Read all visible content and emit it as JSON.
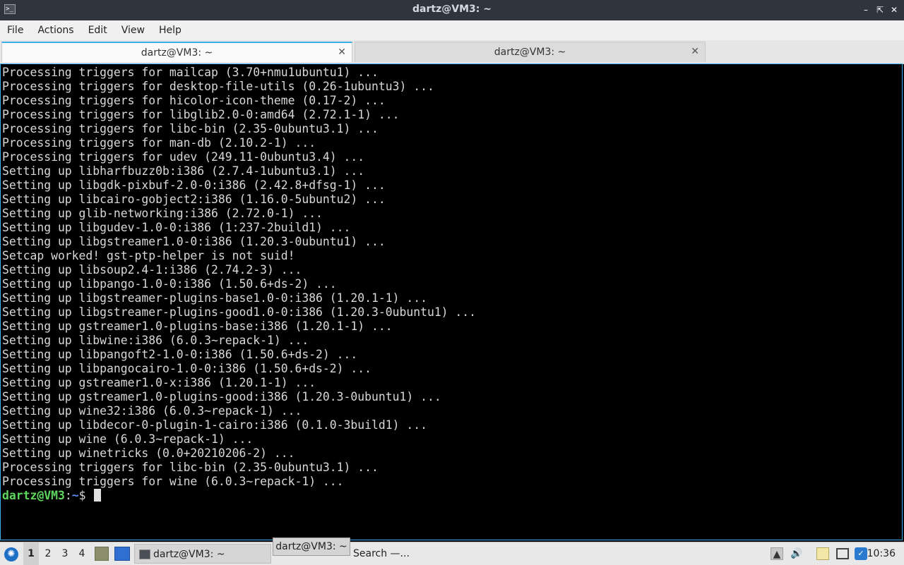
{
  "window": {
    "title": "dartz@VM3: ~",
    "app_icon": "terminal-icon",
    "controls": [
      "minimize-icon",
      "maximize-icon",
      "close-icon"
    ]
  },
  "menu": {
    "items": [
      "File",
      "Actions",
      "Edit",
      "View",
      "Help"
    ]
  },
  "tabs": [
    {
      "label": "dartz@VM3: ~",
      "active": true
    },
    {
      "label": "dartz@VM3: ~",
      "active": false
    }
  ],
  "terminal": {
    "lines": [
      "Processing triggers for mailcap (3.70+nmu1ubuntu1) ...",
      "Processing triggers for desktop-file-utils (0.26-1ubuntu3) ...",
      "Processing triggers for hicolor-icon-theme (0.17-2) ...",
      "Processing triggers for libglib2.0-0:amd64 (2.72.1-1) ...",
      "Processing triggers for libc-bin (2.35-0ubuntu3.1) ...",
      "Processing triggers for man-db (2.10.2-1) ...",
      "Processing triggers for udev (249.11-0ubuntu3.4) ...",
      "Setting up libharfbuzz0b:i386 (2.7.4-1ubuntu3.1) ...",
      "Setting up libgdk-pixbuf-2.0-0:i386 (2.42.8+dfsg-1) ...",
      "Setting up libcairo-gobject2:i386 (1.16.0-5ubuntu2) ...",
      "Setting up glib-networking:i386 (2.72.0-1) ...",
      "Setting up libgudev-1.0-0:i386 (1:237-2build1) ...",
      "Setting up libgstreamer1.0-0:i386 (1.20.3-0ubuntu1) ...",
      "Setcap worked! gst-ptp-helper is not suid!",
      "Setting up libsoup2.4-1:i386 (2.74.2-3) ...",
      "Setting up libpango-1.0-0:i386 (1.50.6+ds-2) ...",
      "Setting up libgstreamer-plugins-base1.0-0:i386 (1.20.1-1) ...",
      "Setting up libgstreamer-plugins-good1.0-0:i386 (1.20.3-0ubuntu1) ...",
      "Setting up gstreamer1.0-plugins-base:i386 (1.20.1-1) ...",
      "Setting up libwine:i386 (6.0.3~repack-1) ...",
      "Setting up libpangoft2-1.0-0:i386 (1.50.6+ds-2) ...",
      "Setting up libpangocairo-1.0-0:i386 (1.50.6+ds-2) ...",
      "Setting up gstreamer1.0-x:i386 (1.20.1-1) ...",
      "Setting up gstreamer1.0-plugins-good:i386 (1.20.3-0ubuntu1) ...",
      "Setting up wine32:i386 (6.0.3~repack-1) ...",
      "Setting up libdecor-0-plugin-1-cairo:i386 (0.1.0-3build1) ...",
      "Setting up wine (6.0.3~repack-1) ...",
      "Setting up winetricks (0.0+20210206-2) ...",
      "Processing triggers for libc-bin (2.35-0ubuntu3.1) ...",
      "Processing triggers for wine (6.0.3~repack-1) ..."
    ],
    "prompt": {
      "user_host": "dartz@VM3",
      "sep": ":",
      "path": "~",
      "symbol": "$ "
    }
  },
  "taskbar": {
    "start_icon": "lubuntu-start-icon",
    "workspaces": [
      "1",
      "2",
      "3",
      "4"
    ],
    "active_workspace": "1",
    "quicklaunch": [
      "file-manager-icon",
      "desktop-icon"
    ],
    "task_label": "dartz@VM3: ~",
    "tooltip": "dartz@VM3: ~",
    "search_label": "Search —...",
    "tray_icons": [
      "upload-icon",
      "volume-icon",
      "clipboard-icon",
      "network-icon",
      "updates-icon"
    ],
    "clock": "10:36"
  }
}
